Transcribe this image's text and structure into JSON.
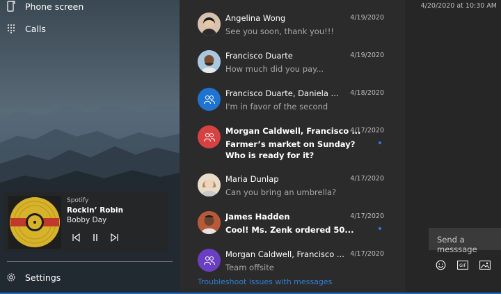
{
  "nav": {
    "phone_screen": "Phone screen",
    "calls": "Calls",
    "settings": "Settings"
  },
  "music": {
    "app": "Spotify",
    "song": "Rockin’ Robin",
    "artist": "Bobby Day"
  },
  "messages": [
    {
      "name": "Angelina Wong",
      "date": "4/19/2020",
      "preview": "See you soon, thank you!!!",
      "unread": false,
      "avatar": "photo"
    },
    {
      "name": "Francisco Duarte",
      "date": "4/19/2020",
      "preview": "How much did you pay...",
      "unread": false,
      "avatar": "photo"
    },
    {
      "name": "Francisco Duarte, Daniela ...",
      "date": "4/18/2020",
      "preview": "I'm in favor of the second",
      "unread": false,
      "avatar": "group-icon",
      "avatar_color": "#1f74d1"
    },
    {
      "name": "Morgan Caldwell, Francisco ...",
      "date": "4/17/2020",
      "preview": "Farmer’s market on Sunday? Who is ready for it?",
      "unread": true,
      "avatar": "group-icon",
      "avatar_color": "#d64242"
    },
    {
      "name": "Maria Dunlap",
      "date": "4/17/2020",
      "preview": "Can you bring an umbrella?",
      "unread": false,
      "avatar": "photo"
    },
    {
      "name": "James Hadden",
      "date": "4/17/2020",
      "preview": "Cool! Ms. Zenk ordered 50...",
      "unread": true,
      "avatar": "photo"
    },
    {
      "name": "Morgan Caldwell, Francisco ...",
      "date": "4/17/2020",
      "preview": "Team offsite",
      "unread": false,
      "avatar": "group-icon",
      "avatar_color": "#6b3fc2"
    }
  ],
  "troubleshoot": "Troubleshoot issues with messages",
  "conversation": {
    "timestamp": "4/20/2020 at 10:30 AM",
    "compose_placeholder": "Send a messsage"
  },
  "colors": {
    "accent": "#2b7bd6",
    "list_bg": "#2b2b2b",
    "conv_bg": "#262626"
  }
}
